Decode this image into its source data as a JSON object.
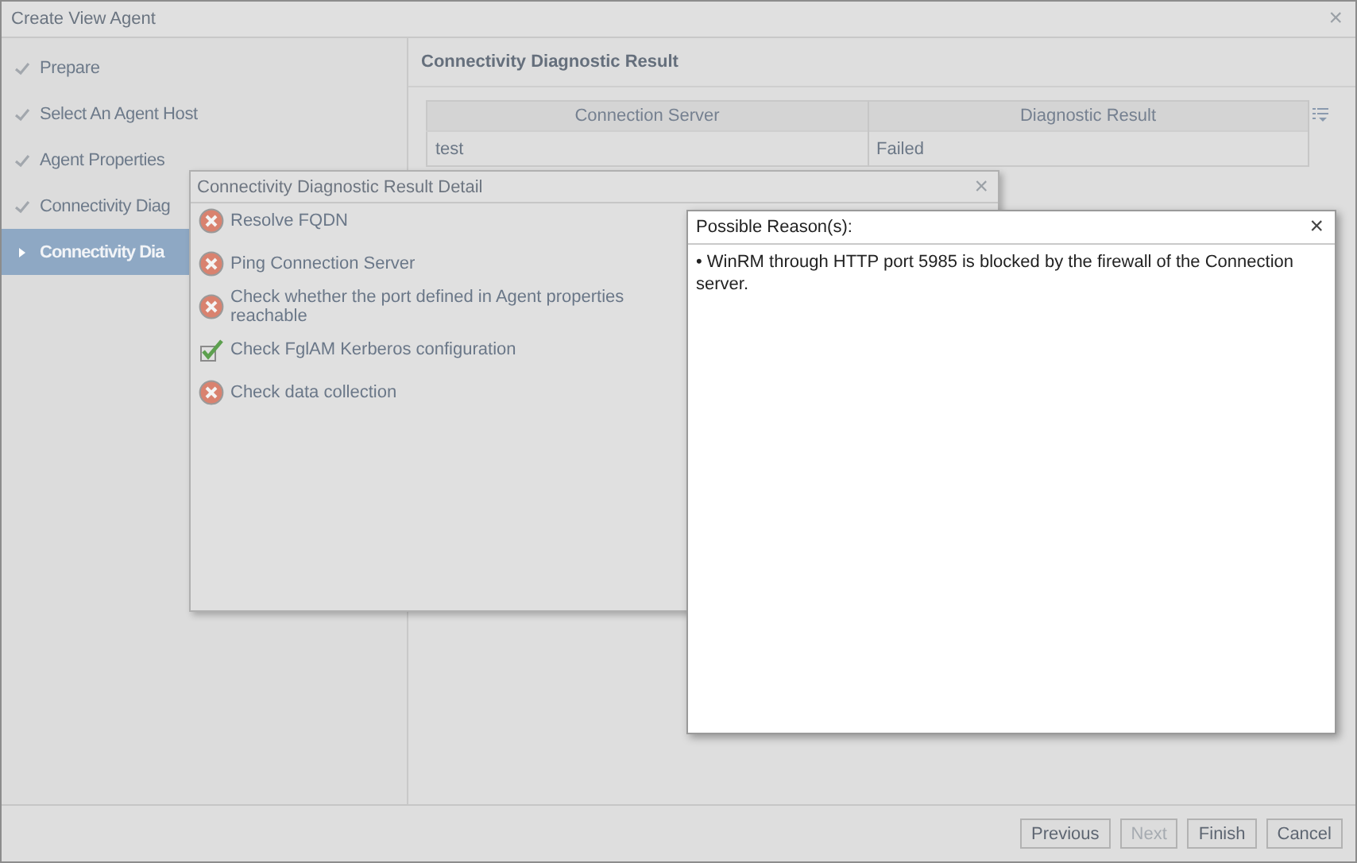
{
  "window": {
    "title": "Create View Agent",
    "close": "×"
  },
  "sidebar": {
    "items": [
      {
        "label": "Prepare",
        "done": true,
        "selected": false
      },
      {
        "label": "Select An Agent Host",
        "done": true,
        "selected": false
      },
      {
        "label": "Agent Properties",
        "done": true,
        "selected": false
      },
      {
        "label": "Connectivity Diag",
        "done": true,
        "selected": false
      },
      {
        "label": "Connectivity Dia",
        "done": false,
        "selected": true
      }
    ]
  },
  "main": {
    "title": "Connectivity Diagnostic Result",
    "table": {
      "columns": [
        "Connection Server",
        "Diagnostic Result"
      ],
      "rows": [
        [
          "test",
          "Failed"
        ]
      ]
    }
  },
  "detail_dialog": {
    "title": "Connectivity Diagnostic Result Detail",
    "close": "×",
    "checks": [
      {
        "label": "Resolve FQDN",
        "kind": "failed"
      },
      {
        "label": "Ping Connection Server",
        "kind": "failed"
      },
      {
        "label": "Check whether the port defined in Agent properties reachable",
        "kind": "failed"
      },
      {
        "label": "Check FglAM Kerberos configuration",
        "kind": "passed"
      },
      {
        "label": "Check data collection",
        "kind": "failed"
      }
    ]
  },
  "reason_popup": {
    "title": "Possible Reason(s):",
    "close": "×",
    "text": "• WinRM through HTTP port 5985 is blocked by the firewall of the Connection server."
  },
  "buttons": [
    {
      "label": "Previous",
      "disabled": false
    },
    {
      "label": "Next",
      "disabled": true
    },
    {
      "label": "Finish",
      "disabled": false
    },
    {
      "label": "Cancel",
      "disabled": false
    }
  ]
}
